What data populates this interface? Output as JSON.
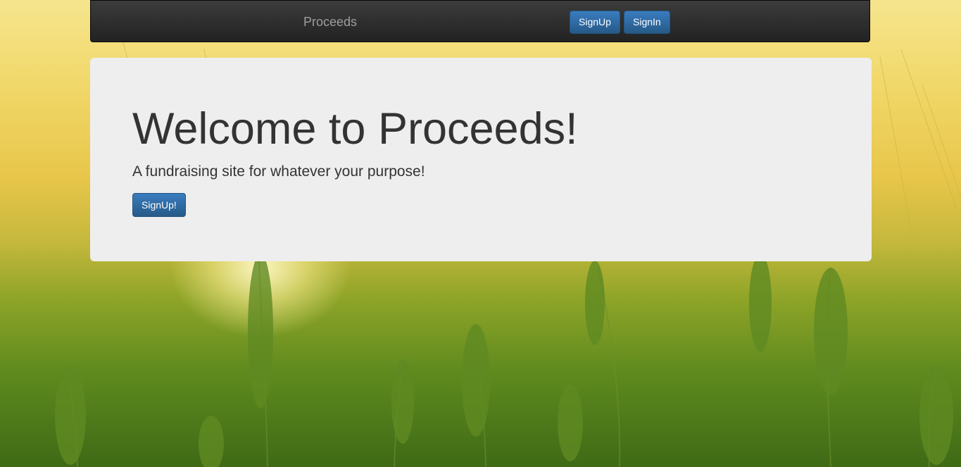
{
  "navbar": {
    "brand": "Proceeds",
    "signup_label": "SignUp",
    "signin_label": "SignIn"
  },
  "hero": {
    "title": "Welcome to Proceeds!",
    "subtitle": "A fundraising site for whatever your purpose!",
    "signup_label": "SignUp!"
  },
  "theme": {
    "navbar_bg": "#222222",
    "primary_button": "#337ab7",
    "jumbotron_bg": "#eeeeee"
  }
}
